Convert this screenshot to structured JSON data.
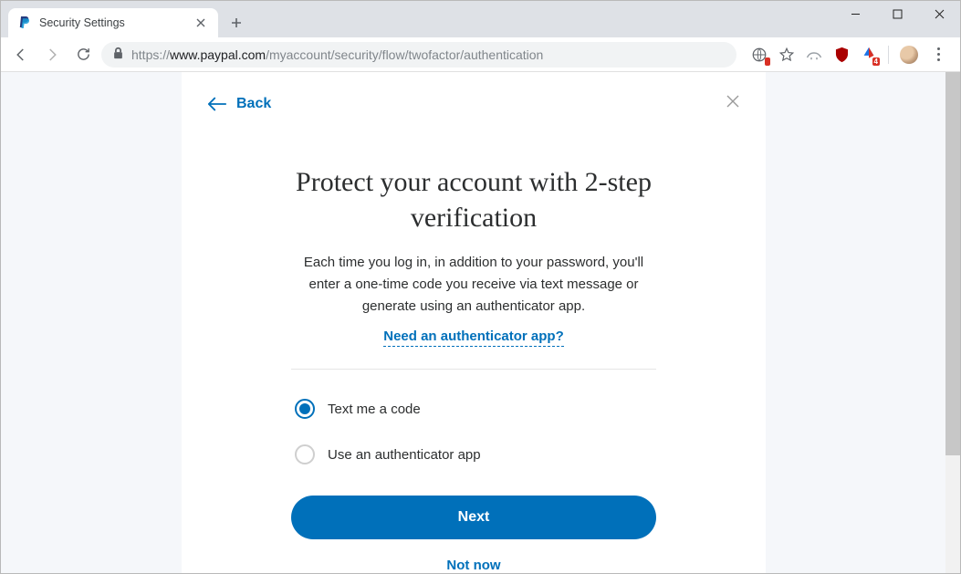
{
  "browser": {
    "tab_title": "Security Settings",
    "url_scheme": "https://",
    "url_host": "www.paypal.com",
    "url_path": "/myaccount/security/flow/twofactor/authentication",
    "ext_badge": "4"
  },
  "panel": {
    "back_label": "Back",
    "heading": "Protect your account with 2-step verification",
    "description": "Each time you log in, in addition to your password, you'll enter a one-time code you receive via text message or generate using an authenticator app.",
    "help_link": "Need an authenticator app?",
    "options": {
      "text_code": "Text me a code",
      "auth_app": "Use an authenticator app"
    },
    "primary_button": "Next",
    "secondary_link": "Not now"
  }
}
